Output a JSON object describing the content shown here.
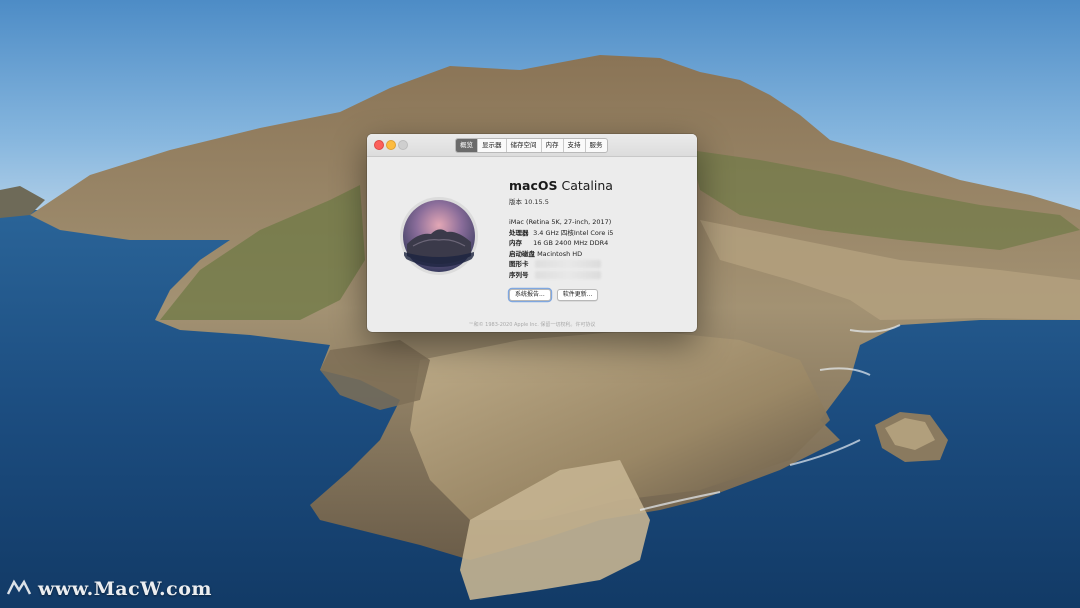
{
  "window": {
    "tabs": [
      {
        "label": "概览",
        "active": true
      },
      {
        "label": "显示器",
        "active": false
      },
      {
        "label": "储存空间",
        "active": false
      },
      {
        "label": "内存",
        "active": false
      },
      {
        "label": "支持",
        "active": false
      },
      {
        "label": "服务",
        "active": false
      }
    ],
    "os_name": "macOS",
    "os_version_name": "Catalina",
    "version_label": "版本 10.15.5",
    "model": "iMac (Retina 5K, 27-inch, 2017)",
    "specs": {
      "processor_label": "处理器",
      "processor_value": "3.4 GHz 四核Intel Core i5",
      "memory_label": "内存",
      "memory_value": "16 GB 2400 MHz DDR4",
      "startup_disk_label": "启动磁盘",
      "startup_disk_value": "Macintosh HD",
      "graphics_label": "图形卡",
      "serial_label": "序列号"
    },
    "buttons": {
      "system_report": "系统报告...",
      "software_update": "软件更新..."
    },
    "footer": "™和© 1983-2020 Apple Inc. 保留一切权利。许可协议"
  },
  "watermark": "www.MacW.com",
  "colors": {
    "close": "#fc605b",
    "minimize": "#fdbc40",
    "tab_active": "#6b6b6b"
  }
}
